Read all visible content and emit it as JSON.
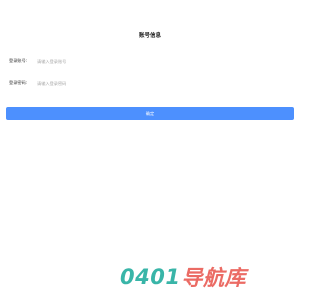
{
  "page": {
    "title": "账号信息"
  },
  "form": {
    "account": {
      "label": "登录账号:",
      "placeholder": "请输入登录账号",
      "value": ""
    },
    "password": {
      "label": "登录密码:",
      "placeholder": "请输入登录密码",
      "value": ""
    },
    "submit_label": "确定"
  },
  "watermark": {
    "number": "0401",
    "text": "导航库"
  },
  "colors": {
    "primary": "#4d90fe",
    "watermark_number": "#17a99a",
    "watermark_text": "#e8524a"
  }
}
